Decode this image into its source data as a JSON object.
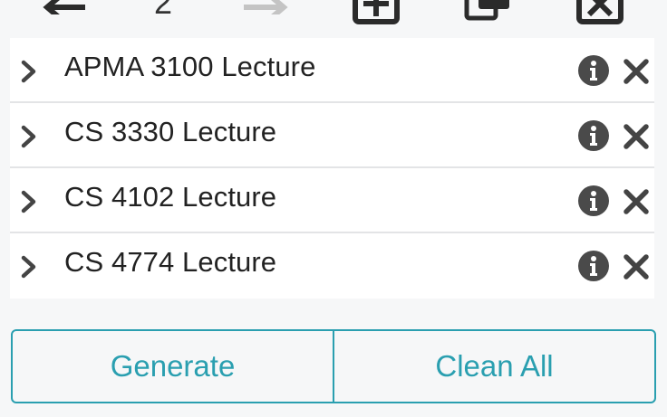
{
  "toolbar": {
    "page_number": "2",
    "icons": [
      "undo-arrow-icon",
      "redo-arrow-icon",
      "add-schedule-icon",
      "copy-schedule-icon",
      "delete-schedule-icon"
    ]
  },
  "courses": [
    {
      "label": "APMA 3100 Lecture"
    },
    {
      "label": "CS 3330 Lecture"
    },
    {
      "label": "CS 4102 Lecture"
    },
    {
      "label": "CS 4774 Lecture"
    }
  ],
  "actions": {
    "generate_label": "Generate",
    "clean_label": "Clean All"
  },
  "colors": {
    "accent": "#2a9fb0",
    "icon_dark": "#4a4a4a",
    "background": "#f6f7f8"
  }
}
